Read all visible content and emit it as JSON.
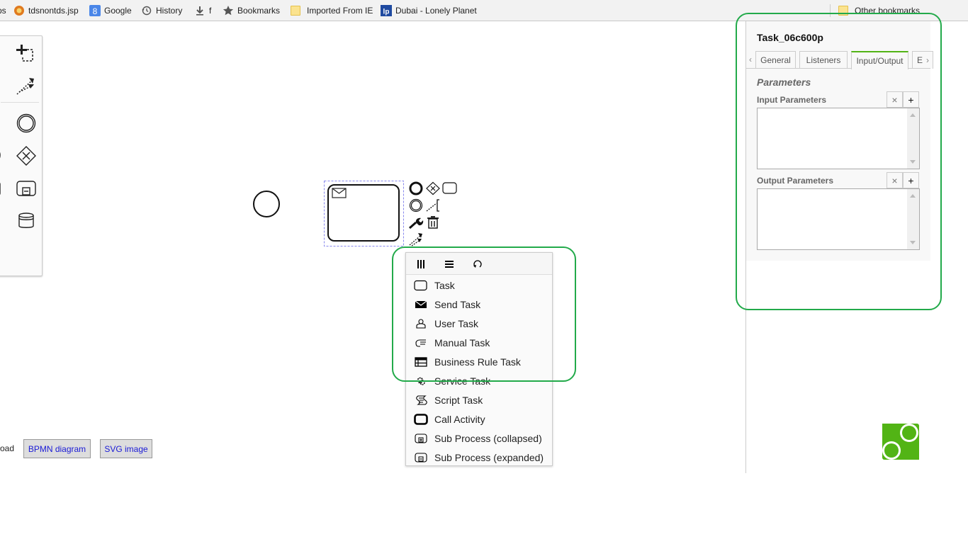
{
  "bookmarks_bar": {
    "items": [
      {
        "label": "ps",
        "icon": "bookmark-icon"
      },
      {
        "label": "tdsnontds.jsp",
        "icon": "site-favicon-icon"
      },
      {
        "label": "Google",
        "icon": "google-icon"
      },
      {
        "label": "History",
        "icon": "history-icon"
      },
      {
        "label": "f",
        "icon": "download-icon"
      },
      {
        "label": "Bookmarks",
        "icon": "star-icon"
      },
      {
        "label": "Imported From IE",
        "icon": "folder-icon"
      },
      {
        "label": "Dubai - Lonely Planet",
        "icon": "lonely-planet-icon"
      }
    ],
    "other": {
      "label": "Other bookmarks",
      "icon": "folder-icon"
    }
  },
  "palette": {
    "tools": [
      "lasso-tool",
      "space-tool",
      "global-connect-tool",
      "create-start-event",
      "create-end-event",
      "create-intermediate-event",
      "create-gateway",
      "create-task",
      "create-subprocess",
      "create-data-object",
      "create-data-store",
      "create-participant"
    ]
  },
  "canvas": {
    "start_event": "start-event",
    "selected_element": "Task_06c600p",
    "selected_type": "Send Task"
  },
  "context_pad": {
    "actions": [
      "append-end-event",
      "append-gateway",
      "append-task",
      "append-intermediate-event",
      "append-text-annotation",
      "replace",
      "delete",
      "connect"
    ]
  },
  "replace_menu": {
    "header_actions": [
      "parallel-multi-instance",
      "sequential-multi-instance",
      "loop"
    ],
    "entries": [
      {
        "label": "Task",
        "icon": "task-icon"
      },
      {
        "label": "Send Task",
        "icon": "send-task-icon"
      },
      {
        "label": "User Task",
        "icon": "user-task-icon"
      },
      {
        "label": "Manual Task",
        "icon": "manual-task-icon"
      },
      {
        "label": "Business Rule Task",
        "icon": "business-rule-task-icon"
      },
      {
        "label": "Service Task",
        "icon": "service-task-icon"
      },
      {
        "label": "Script Task",
        "icon": "script-task-icon"
      },
      {
        "label": "Call Activity",
        "icon": "call-activity-icon"
      },
      {
        "label": "Sub Process (collapsed)",
        "icon": "subprocess-collapsed-icon"
      },
      {
        "label": "Sub Process (expanded)",
        "icon": "subprocess-expanded-icon"
      }
    ]
  },
  "download": {
    "label": "Download",
    "visible_label": "oad",
    "buttons": [
      "BPMN diagram",
      "SVG image"
    ]
  },
  "properties_panel": {
    "title": "Task_06c600p",
    "tabs": [
      {
        "label": "General",
        "active": false
      },
      {
        "label": "Listeners",
        "active": false
      },
      {
        "label": "Input/Output",
        "active": true
      },
      {
        "label": "E",
        "active": false
      }
    ],
    "prev_arrow": "‹",
    "next_arrow": "›",
    "group_title": "Parameters",
    "input_parameters": {
      "label": "Input Parameters",
      "remove": "×",
      "add": "+",
      "items": []
    },
    "output_parameters": {
      "label": "Output Parameters",
      "remove": "×",
      "add": "+",
      "items": []
    }
  },
  "colors": {
    "accent": "#52b415",
    "annotation": "#22aa4a",
    "link": "#1a1ad6"
  }
}
